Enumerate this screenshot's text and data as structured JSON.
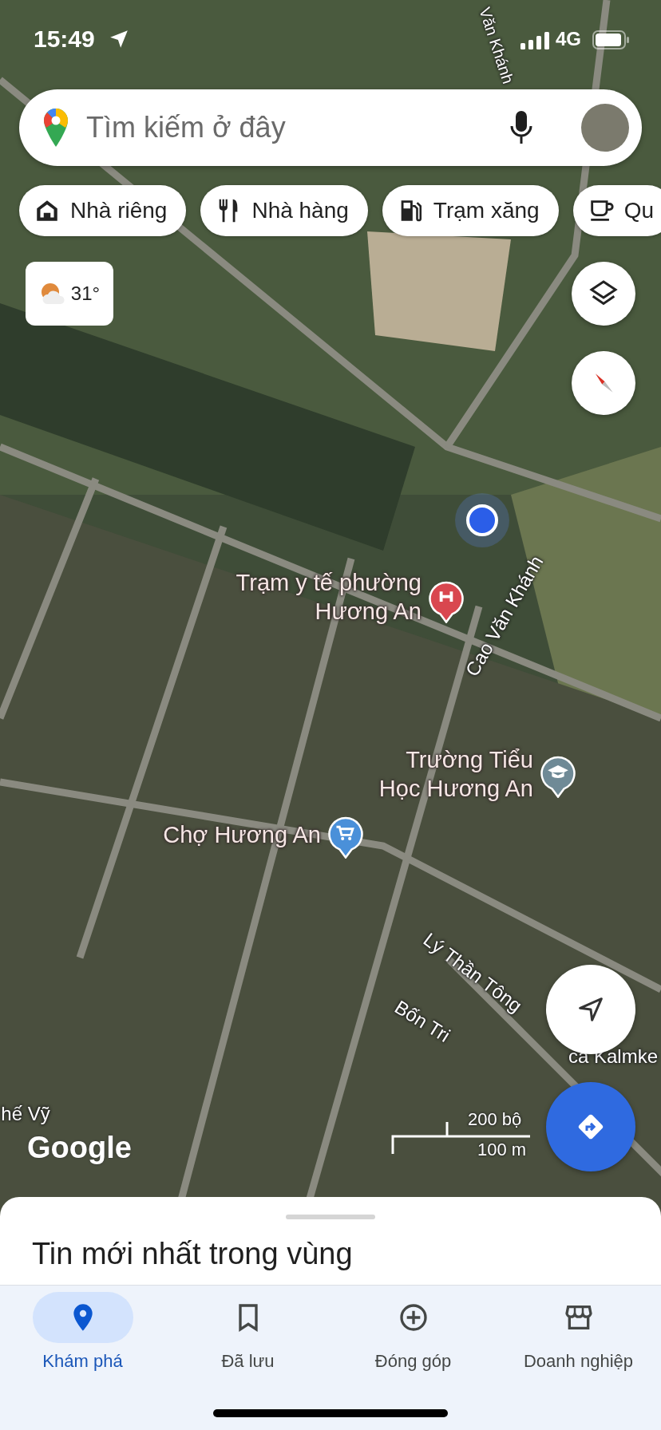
{
  "status_bar": {
    "time": "15:49",
    "network": "4G"
  },
  "search": {
    "placeholder": "Tìm kiếm ở đây"
  },
  "chips": [
    {
      "kind": "home",
      "label": "Nhà riêng"
    },
    {
      "kind": "restaurant",
      "label": "Nhà hàng"
    },
    {
      "kind": "gas",
      "label": "Trạm xăng"
    },
    {
      "kind": "cafe",
      "label": "Qu"
    }
  ],
  "weather": {
    "temperature": "31°"
  },
  "places": [
    {
      "kind": "hospital",
      "name": "Trạm y tế phường\nHương An",
      "color": "#d9474f"
    },
    {
      "kind": "school",
      "name": "Trường Tiểu\nHọc Hương An",
      "color": "#6f8a96"
    },
    {
      "kind": "shop",
      "name": "Chợ Hương An",
      "color": "#4a90d9"
    }
  ],
  "roads": [
    "Văn Khánh",
    "Cao Văn Khánh",
    "Lý Thần Tông",
    "Bốn Tri",
    "ca Kalmke",
    "hế Vỹ"
  ],
  "map_attribution": "Google",
  "scale": {
    "imperial": "200 bộ",
    "metric": "100 m"
  },
  "sheet": {
    "title": "Tin mới nhất trong vùng"
  },
  "nav": [
    {
      "kind": "explore",
      "label": "Khám phá",
      "selected": true
    },
    {
      "kind": "saved",
      "label": "Đã lưu",
      "selected": false
    },
    {
      "kind": "contribute",
      "label": "Đóng góp",
      "selected": false
    },
    {
      "kind": "business",
      "label": "Doanh nghiệp",
      "selected": false
    }
  ]
}
